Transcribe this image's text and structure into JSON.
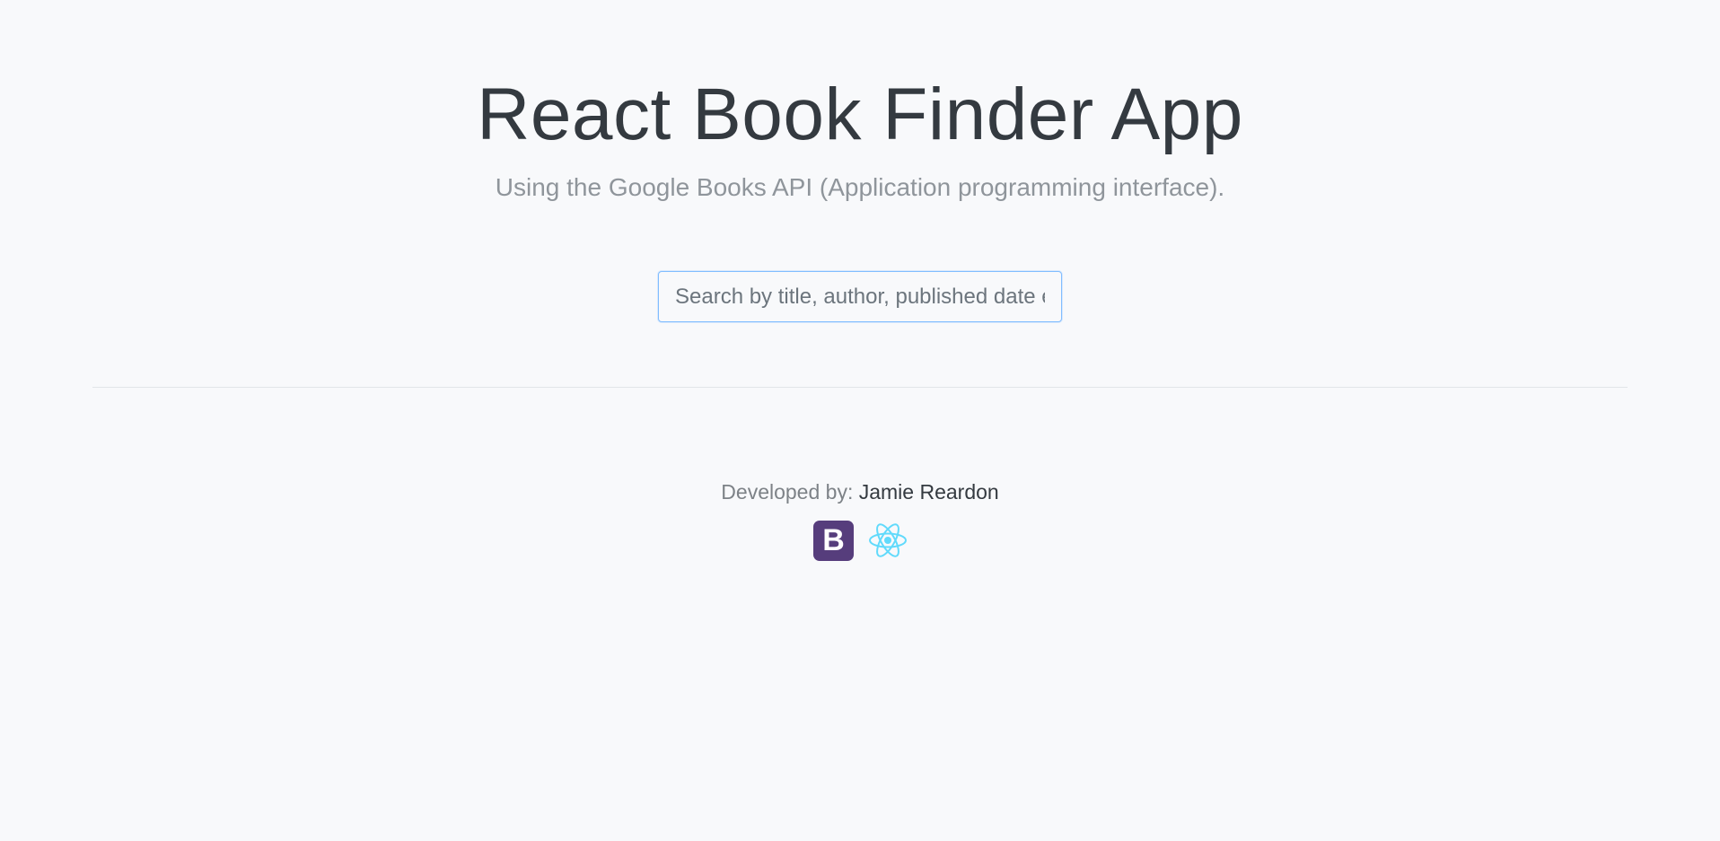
{
  "header": {
    "title": "React Book Finder App",
    "subtitle": "Using the Google Books API (Application programming interface)."
  },
  "search": {
    "value": "",
    "placeholder": "Search by title, author, published date etc."
  },
  "footer": {
    "credit_label": "Developed by:",
    "credit_name": "Jamie Reardon",
    "logos": [
      {
        "icon": "bootstrap-icon",
        "text": "B",
        "color": "#563d7c"
      },
      {
        "icon": "react-icon",
        "color": "#61dafb"
      }
    ]
  },
  "colors": {
    "background": "#f8f9fb",
    "title": "#343a40",
    "subtitle": "#8f959b",
    "input_focus_border": "#80bdff",
    "bootstrap_purple": "#563d7c",
    "react_cyan": "#61dafb"
  }
}
